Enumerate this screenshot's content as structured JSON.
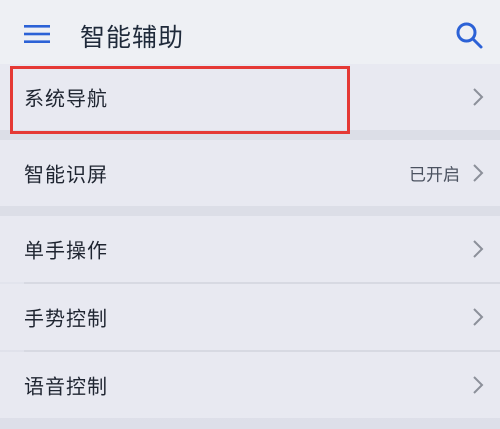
{
  "header": {
    "title": "智能辅助",
    "icons": {
      "menu": "hamburger-menu-icon",
      "search": "search-icon"
    }
  },
  "settings": {
    "items": [
      {
        "label": "系统导航",
        "value": ""
      },
      {
        "label": "智能识屏",
        "value": "已开启"
      },
      {
        "label": "单手操作",
        "value": ""
      },
      {
        "label": "手势控制",
        "value": ""
      },
      {
        "label": "语音控制",
        "value": ""
      }
    ]
  },
  "colors": {
    "highlight_border": "#e53935",
    "title_text": "#1f2a3a",
    "background": "#e8e9f1"
  }
}
